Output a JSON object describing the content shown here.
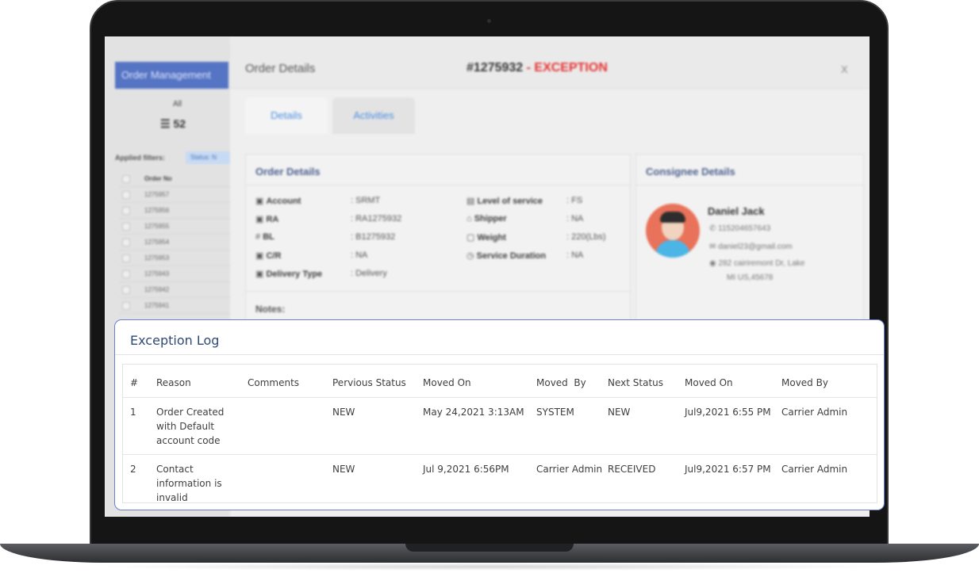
{
  "background_app": {
    "sidebar": {
      "header": "Order Management",
      "all_label": "All",
      "count": "52",
      "applied_filters_label": "Applied filters:",
      "filter_chip": "Status: N",
      "column_header": "Order No",
      "orders": [
        "1275957",
        "1275956",
        "1275955",
        "1275954",
        "1275953",
        "1275943",
        "1275942",
        "1275941"
      ]
    },
    "panel": {
      "title": "Order Details",
      "order_number": "#1275932",
      "order_status": " - EXCEPTION",
      "close_label": "X",
      "tabs": [
        "Details",
        "Activities"
      ],
      "order_details": {
        "title": "Order Details",
        "left_fields": [
          {
            "label": "Account",
            "value": ": SRMT"
          },
          {
            "label": "RA",
            "value": ": RA1275932"
          },
          {
            "label": "BL",
            "value": ": B1275932"
          },
          {
            "label": "C/R",
            "value": ": NA"
          },
          {
            "label": "Delivery Type",
            "value": ": Delivery"
          }
        ],
        "right_fields": [
          {
            "label": "Level of service",
            "value": ": FS"
          },
          {
            "label": "Shipper",
            "value": ": NA"
          },
          {
            "label": "Weight",
            "value": ": 220(Lbs)"
          },
          {
            "label": "Service Duration",
            "value": ": NA"
          }
        ],
        "notes_label": "Notes:"
      },
      "consignee": {
        "title": "Consignee Details",
        "name": "Daniel Jack",
        "phone": "115204657643",
        "email": "daniel23@gmail.com",
        "address_line1": "282 cairiremont Dr, Lake",
        "address_line2": "MI US,45678"
      }
    }
  },
  "exception_log": {
    "title": "Exception Log",
    "columns": [
      "#",
      "Reason",
      "Comments",
      "Pervious Status",
      "Moved On",
      "Moved  By",
      "Next Status",
      "Moved On",
      "Moved By"
    ],
    "rows": [
      {
        "index": "1",
        "reason": "Order Created with Default account code",
        "comments": "",
        "previous_status": "NEW",
        "moved_on": "May 24,2021 3:13AM",
        "moved_by": "SYSTEM",
        "next_status": "NEW",
        "next_moved_on": "Jul9,2021 6:55 PM",
        "next_moved_by": "Carrier Admin"
      },
      {
        "index": "2",
        "reason": "Contact information is invalid",
        "comments": "",
        "previous_status": "NEW",
        "moved_on": "Jul 9,2021 6:56PM",
        "moved_by": "Carrier Admin",
        "next_status": "RECEIVED",
        "next_moved_on": "Jul9,2021 6:57 PM",
        "next_moved_by": "Carrier Admin"
      }
    ]
  },
  "colors": {
    "accent_border": "#6b7fd1",
    "title_text": "#2f4a75",
    "exception_red": "#e53232",
    "sidebar_header": "#5574c4",
    "tab_text": "#4d8fe0"
  }
}
